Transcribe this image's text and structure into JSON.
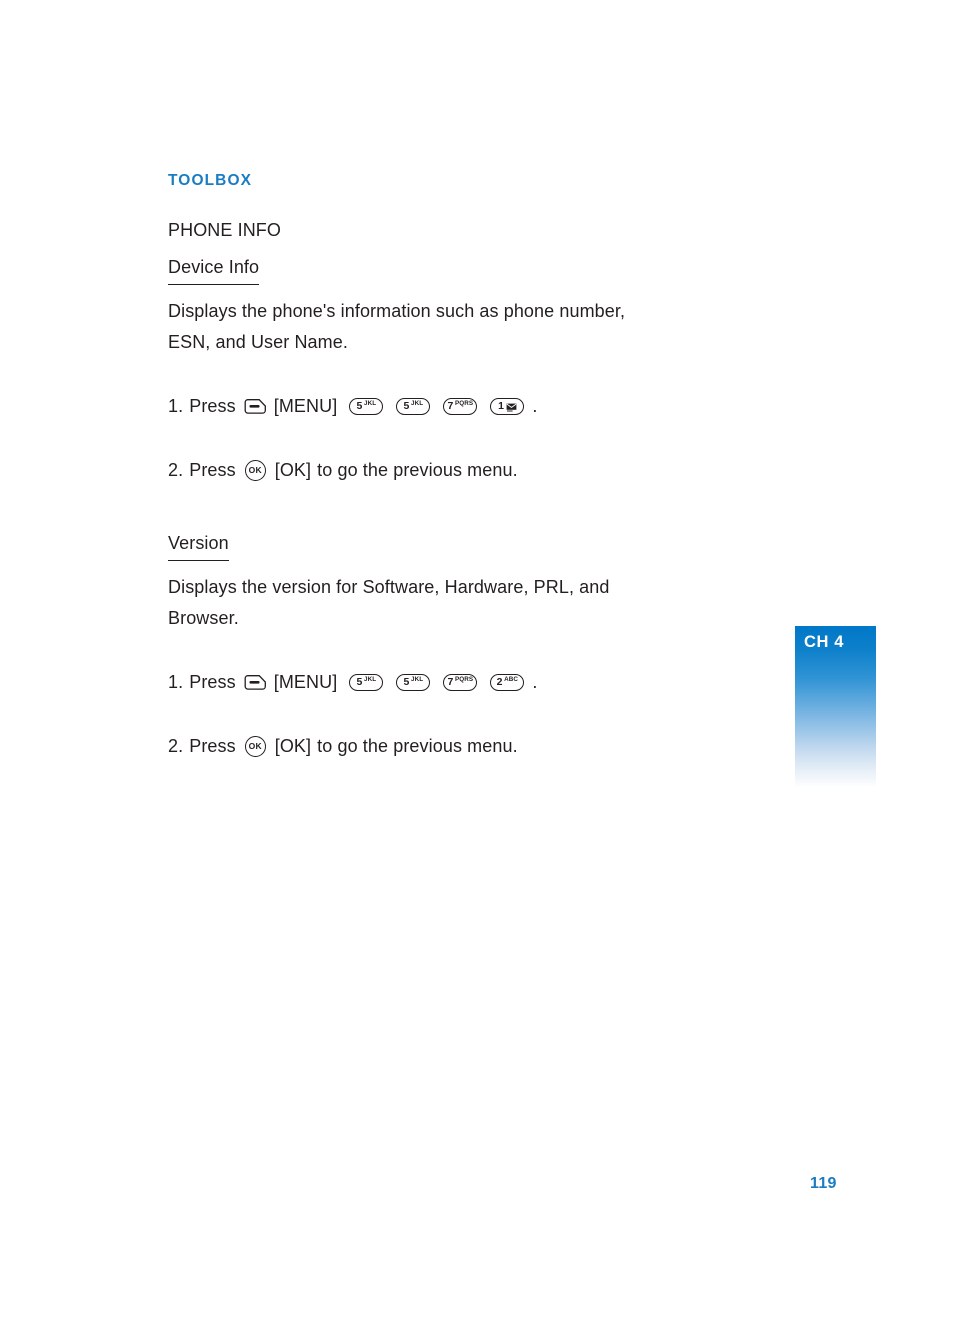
{
  "page": {
    "number": "119",
    "chapter_tab": "CH 4",
    "accent_color": "#1a7cc2",
    "text_color": "#231f20"
  },
  "content": {
    "section_heading": "TOOLBOX",
    "subject": "PHONE INFO",
    "topics": [
      {
        "title": "Device Info",
        "description": "Displays the phone's information such as phone number, ESN, and User Name.",
        "steps": [
          {
            "number": "1.",
            "verb": "Press",
            "menu_key_name": "menu-soft-key",
            "bracket_label": "[MENU]",
            "keys": [
              {
                "digit": "5",
                "letters": "JKL",
                "glyph": ""
              },
              {
                "digit": "5",
                "letters": "JKL",
                "glyph": ""
              },
              {
                "digit": "7",
                "letters": "PQRS",
                "glyph": ""
              },
              {
                "digit": "1",
                "letters": "",
                "glyph": "envelope"
              }
            ],
            "trailing": "."
          },
          {
            "number": "2.",
            "verb": "Press",
            "ok_key_label": "OK",
            "bracket_label": "[OK]",
            "tail": "to go the previous menu."
          }
        ]
      },
      {
        "title": "Version",
        "description": "Displays the version for Software, Hardware, PRL, and Browser.",
        "steps": [
          {
            "number": "1.",
            "verb": "Press",
            "menu_key_name": "menu-soft-key",
            "bracket_label": "[MENU]",
            "keys": [
              {
                "digit": "5",
                "letters": "JKL",
                "glyph": ""
              },
              {
                "digit": "5",
                "letters": "JKL",
                "glyph": ""
              },
              {
                "digit": "7",
                "letters": "PQRS",
                "glyph": ""
              },
              {
                "digit": "2",
                "letters": "ABC",
                "glyph": ""
              }
            ],
            "trailing": "."
          },
          {
            "number": "2.",
            "verb": "Press",
            "ok_key_label": "OK",
            "bracket_label": "[OK]",
            "tail": "to go the previous menu."
          }
        ]
      }
    ]
  }
}
